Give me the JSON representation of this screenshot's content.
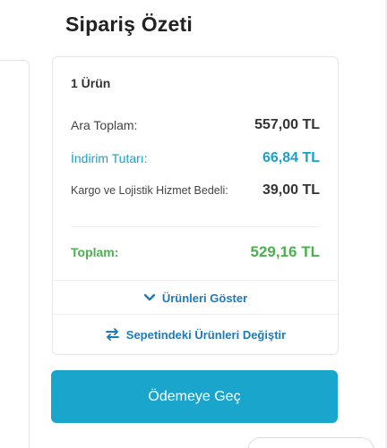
{
  "summary": {
    "title": "Sipariş Özeti",
    "item_count": "1 Ürün",
    "subtotal": {
      "label": "Ara Toplam:",
      "value": "557,00 TL"
    },
    "discount": {
      "label": "İndirim Tutarı:",
      "value": "66,84 TL"
    },
    "shipping": {
      "label": "Kargo ve Lojistik Hizmet Bedeli:",
      "value": "39,00 TL"
    },
    "total": {
      "label": "Toplam:",
      "value": "529,16 TL"
    },
    "show_products_label": "Ürünleri Göster",
    "change_products_label": "Sepetindeki Ürünleri Değiştir",
    "pay_button_label": "Ödemeye Geç"
  },
  "colors": {
    "accent": "#1aa6cc",
    "discount": "#1aa0c9",
    "total": "#4caf50",
    "link": "#1e7ab8"
  },
  "icons": {
    "show_products": "chevron-down-icon",
    "change_products": "swap-arrows-icon"
  }
}
